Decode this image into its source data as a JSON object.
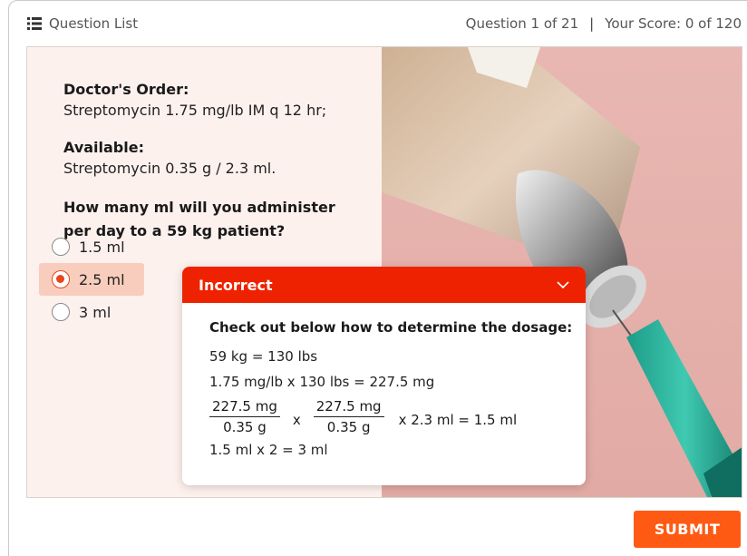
{
  "header": {
    "question_list_label": "Question List",
    "question_progress": "Question 1 of 21",
    "separator": "|",
    "score": "Your Score: 0 of 120"
  },
  "question": {
    "order_heading": "Doctor's Order:",
    "order_text": "Streptomycin 1.75 mg/lb IM q 12 hr;",
    "available_heading": "Available:",
    "available_text": "Streptomycin 0.35 g / 2.3 ml.",
    "prompt_line1": "How many ml will you administer",
    "prompt_line2": "per day to a 59 kg patient?"
  },
  "options": [
    {
      "label": "1.5 ml",
      "selected": false
    },
    {
      "label": "2.5 ml",
      "selected": true
    },
    {
      "label": "3 ml",
      "selected": false
    }
  ],
  "feedback": {
    "title": "Incorrect",
    "intro": "Check out below how to determine the dosage:",
    "step1": "59 kg = 130 lbs",
    "step2": "1.75 mg/lb x 130 lbs = 227.5 mg",
    "frac1_num": "227.5 mg",
    "frac1_den": "0.35 g",
    "frac_op": "x",
    "frac2_num": "227.5 mg",
    "frac2_den": "0.35 g",
    "calc_tail": "x  2.3 ml  =  1.5 ml",
    "step4": "1.5 ml  x  2  =  3 ml"
  },
  "submit_label": "SUBMIT",
  "colors": {
    "accent": "#ff5a14",
    "incorrect_banner": "#ee2200",
    "selected_option_bg": "#f8cdbd",
    "panel_bg": "#fdf1ee"
  }
}
